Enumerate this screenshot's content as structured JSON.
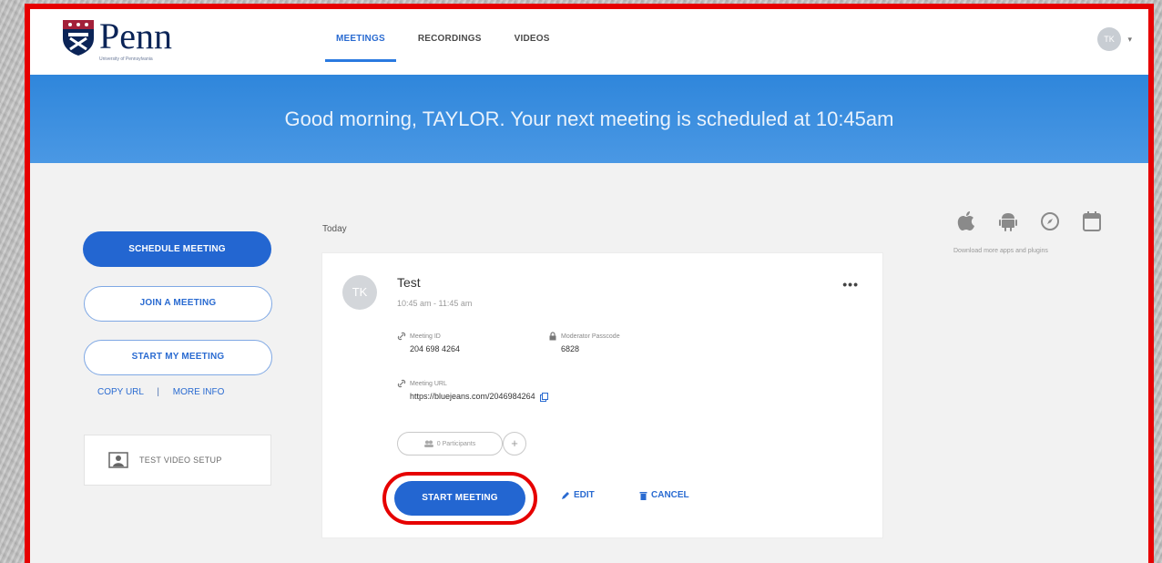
{
  "brand": {
    "name": "Penn",
    "subtitle": "University of Pennsylvania"
  },
  "nav": {
    "tabs": [
      {
        "label": "MEETINGS",
        "active": true
      },
      {
        "label": "RECORDINGS",
        "active": false
      },
      {
        "label": "VIDEOS",
        "active": false
      }
    ],
    "user_initials": "TK"
  },
  "banner": {
    "greeting": "Good morning, TAYLOR. Your next meeting is scheduled at 10:45am"
  },
  "sidebar": {
    "schedule_label": "SCHEDULE MEETING",
    "join_label": "JOIN A MEETING",
    "start_my_label": "START MY MEETING",
    "copy_url_label": "COPY URL",
    "separator": "|",
    "more_info_label": "MORE INFO",
    "test_video_label": "TEST VIDEO SETUP"
  },
  "meetings": {
    "day_label": "Today",
    "card": {
      "initials": "TK",
      "title": "Test",
      "time": "10:45 am - 11:45 am",
      "more": "•••",
      "meeting_id_label": "Meeting ID",
      "meeting_id": "204 698 4264",
      "passcode_label": "Moderator Passcode",
      "passcode": "6828",
      "url_label": "Meeting URL",
      "url": "https://bluejeans.com/2046984264",
      "participants_label": "0 Participants",
      "add_symbol": "+",
      "start_label": "START MEETING",
      "edit_label": "EDIT",
      "cancel_label": "CANCEL"
    }
  },
  "apps": {
    "icons": [
      "apple-icon",
      "android-icon",
      "browser-icon",
      "calendar-icon"
    ],
    "caption": "Download more apps and plugins"
  },
  "colors": {
    "primary": "#2366d1",
    "banner": "#3a8fe0",
    "highlight": "#e60000",
    "logo": "#0b2457"
  }
}
